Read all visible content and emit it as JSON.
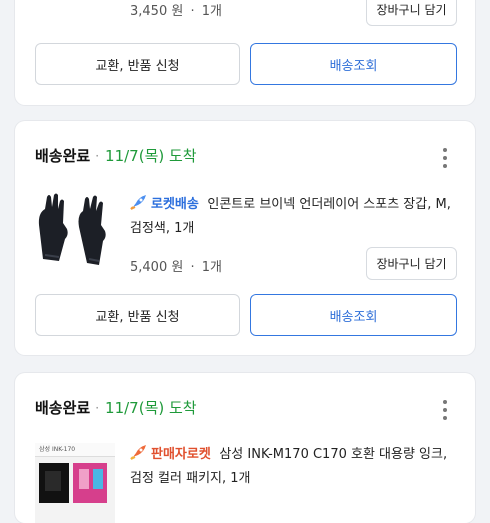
{
  "orders": [
    {
      "price": "3,450 원",
      "qty": "1개",
      "cart_label": "장바구니 담기",
      "exchange_label": "교환, 반품 신청",
      "track_label": "배송조회"
    },
    {
      "status": "배송완료",
      "date": "11/7(목) 도착",
      "badge": "로켓배송",
      "title": "인콘트로 브이넥 언더레이어 스포츠 장갑, M, 검정색, 1개",
      "price": "5,400 원",
      "qty": "1개",
      "cart_label": "장바구니 담기",
      "exchange_label": "교환, 반품 신청",
      "track_label": "배송조회"
    },
    {
      "status": "배송완료",
      "date": "11/7(목) 도착",
      "badge": "판매자로켓",
      "title": "삼성 INK-M170 C170 호환 대용량 잉크, 검정 컬러 패키지, 1개",
      "product_label": "삼성 INK-170"
    }
  ],
  "separator": "·",
  "colors": {
    "accent_blue": "#2f6fd8",
    "arrival_green": "#1f9a3a",
    "seller_rocket": "#e0502e"
  }
}
